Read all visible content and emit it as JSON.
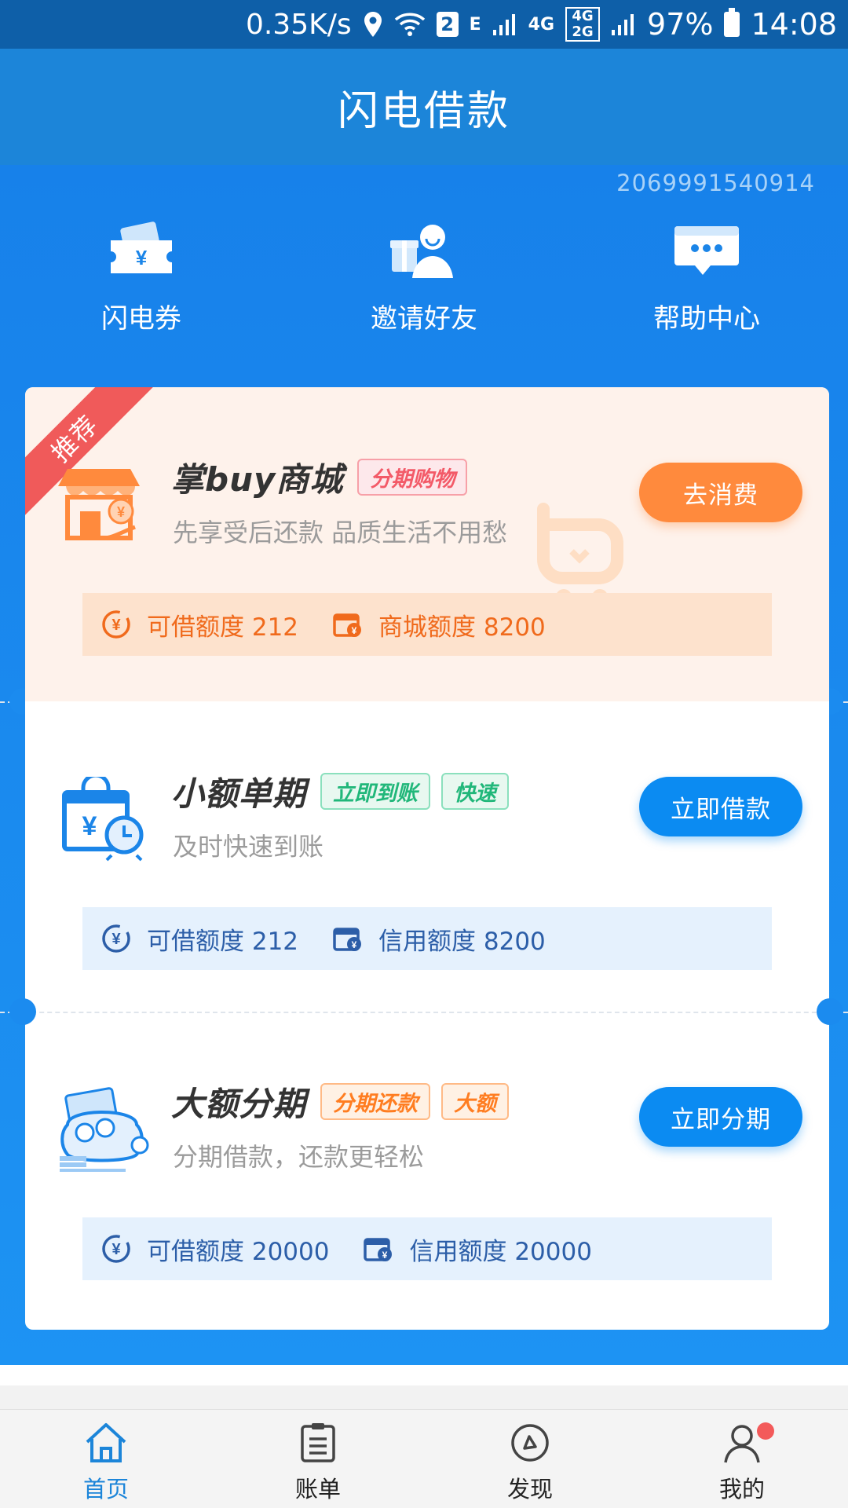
{
  "status_bar": {
    "speed": "0.35K/s",
    "sim_badge": "2",
    "net_e": "E",
    "net_4g": "4G",
    "net_4g2g": "4G 2G",
    "battery": "97%",
    "time": "14:08"
  },
  "header": {
    "title": "闪电借款"
  },
  "user_id": "2069991540914",
  "quick_actions": [
    {
      "label": "闪电券",
      "icon": "ticket-icon"
    },
    {
      "label": "邀请好友",
      "icon": "invite-friend-icon"
    },
    {
      "label": "帮助中心",
      "icon": "chat-help-icon"
    }
  ],
  "products": [
    {
      "ribbon": "推荐",
      "title": "掌buy商城",
      "tags": [
        "分期购物"
      ],
      "subtitle": "先享受后还款 品质生活不用愁",
      "button": "去消费",
      "quota_1": "可借额度 212",
      "quota_2": "商城额度 8200"
    },
    {
      "title": "小额单期",
      "tags": [
        "立即到账",
        "快速"
      ],
      "subtitle": "及时快速到账",
      "button": "立即借款",
      "quota_1": "可借额度 212",
      "quota_2": "信用额度 8200"
    },
    {
      "title": "大额分期",
      "tags": [
        "分期还款",
        "大额"
      ],
      "subtitle": "分期借款，还款更轻松",
      "button": "立即分期",
      "quota_1": "可借额度 20000",
      "quota_2": "信用额度 20000"
    }
  ],
  "tabs": [
    {
      "label": "首页",
      "icon": "home-icon",
      "active": true
    },
    {
      "label": "账单",
      "icon": "bill-icon",
      "active": false
    },
    {
      "label": "发现",
      "icon": "compass-icon",
      "active": false
    },
    {
      "label": "我的",
      "icon": "user-icon",
      "active": false
    }
  ],
  "colors": {
    "brand_blue": "#1c85d9",
    "accent_orange": "#ff8a3d",
    "button_blue": "#0b8bf2"
  }
}
